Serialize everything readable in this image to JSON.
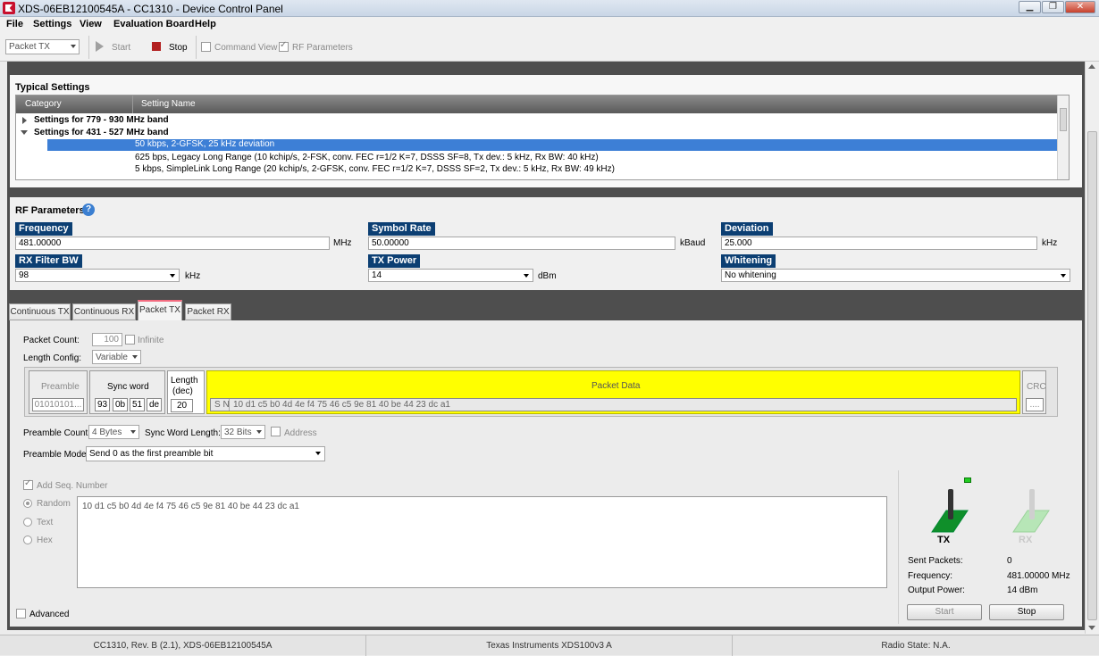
{
  "window": {
    "title": "XDS-06EB12100545A - CC1310 - Device Control Panel"
  },
  "menu": [
    "File",
    "Settings",
    "View",
    "Evaluation Board",
    "Help"
  ],
  "toolbar": {
    "mode_select": "Packet TX",
    "start_label": "Start",
    "stop_label": "Stop",
    "command_view_label": "Command View",
    "rf_parameters_label": "RF Parameters"
  },
  "typical": {
    "title": "Typical Settings",
    "col_category": "Category",
    "col_setting": "Setting Name",
    "rows": [
      {
        "label": "Settings for 779 - 930 MHz band"
      },
      {
        "label": "Settings for 431 - 527 MHz band"
      },
      {
        "label": "50 kbps, 2-GFSK, 25 kHz deviation"
      },
      {
        "label": "625 bps, Legacy Long Range (10 kchip/s, 2-FSK, conv. FEC r=1/2 K=7, DSSS SF=8, Tx dev.: 5 kHz, Rx BW: 40 kHz)"
      },
      {
        "label": "5 kbps, SimpleLink Long Range (20 kchip/s, 2-GFSK, conv. FEC r=1/2 K=7, DSSS SF=2, Tx dev.: 5 kHz, Rx BW: 49 kHz)"
      }
    ]
  },
  "rf": {
    "title": "RF Parameters",
    "frequency_label": "Frequency",
    "frequency_value": "481.00000",
    "frequency_unit": "MHz",
    "symbol_rate_label": "Symbol Rate",
    "symbol_rate_value": "50.00000",
    "symbol_rate_unit": "kBaud",
    "deviation_label": "Deviation",
    "deviation_value": "25.000",
    "deviation_unit": "kHz",
    "rx_bw_label": "RX Filter BW",
    "rx_bw_value": "98",
    "rx_bw_unit": "kHz",
    "tx_power_label": "TX Power",
    "tx_power_value": "14",
    "tx_power_unit": "dBm",
    "whitening_label": "Whitening",
    "whitening_value": "No whitening"
  },
  "tabs": [
    "Continuous TX",
    "Continuous RX",
    "Packet TX",
    "Packet RX"
  ],
  "packet": {
    "count_label": "Packet Count:",
    "count_value": "100",
    "infinite_label": "Infinite",
    "length_config_label": "Length Config:",
    "length_config_value": "Variable",
    "preamble_label": "Preamble",
    "preamble_value": "01010101...",
    "sync_word_label": "Sync word",
    "sync_bytes": [
      "93",
      "0b",
      "51",
      "de"
    ],
    "length_label": "Length",
    "length_sub": "(dec)",
    "length_value": "20",
    "packet_data_label": "Packet Data",
    "sn_label": "S N",
    "packet_data_value": "10 d1 c5 b0 4d 4e f4 75 46 c5 9e 81 40 be 44 23 dc a1",
    "crc_label": "CRC",
    "crc_value": "....",
    "preamble_count_label": "Preamble Count:",
    "preamble_count_value": "4 Bytes",
    "sync_length_label": "Sync Word Length:",
    "sync_length_value": "32 Bits",
    "address_label": "Address",
    "preamble_mode_label": "Preamble Mode:",
    "preamble_mode_value": "Send 0 as the first preamble bit",
    "add_seq_label": "Add Seq. Number",
    "radio_random": "Random",
    "radio_text": "Text",
    "radio_hex": "Hex",
    "payload_text": "10 d1 c5 b0 4d 4e f4 75 46 c5 9e 81 40 be 44 23 dc a1",
    "advanced_label": "Advanced"
  },
  "stats": {
    "tx_label": "TX",
    "rx_label": "RX",
    "sent_label": "Sent Packets:",
    "sent_value": "0",
    "freq_label": "Frequency:",
    "freq_value": "481.00000 MHz",
    "power_label": "Output Power:",
    "power_value": "14 dBm",
    "start_label": "Start",
    "stop_label": "Stop"
  },
  "status": {
    "device": "CC1310, Rev. B (2.1), XDS-06EB12100545A",
    "probe": "Texas Instruments XDS100v3 A",
    "radio_state": "Radio State: N.A."
  },
  "colors": {
    "label_blue": "#0c3f73",
    "selection": "#3d7fd6",
    "packet_yellow": "#ffff00",
    "tab_accent": "#f36b7f",
    "led_green": "#22cc22"
  }
}
